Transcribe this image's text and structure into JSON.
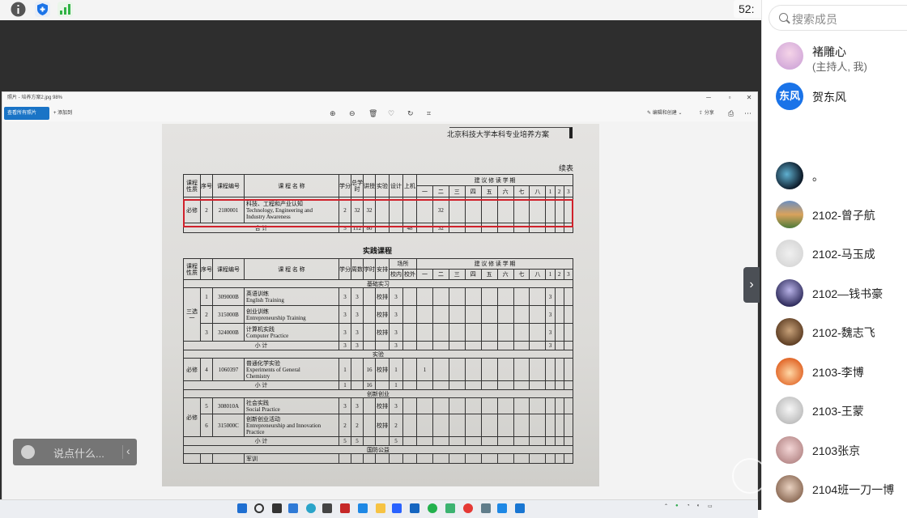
{
  "timer": "52:",
  "viewer": {
    "title": "照片 - 培养方案2.jpg  98%",
    "primary_button": "查看所有照片",
    "add_label": "添加到",
    "edit_label": "编辑和创建",
    "share_label": "分享"
  },
  "paper": {
    "header": "北京科技大学本科专业培养方案",
    "continued": "续表",
    "section_practice": "实践课程"
  },
  "table1": {
    "headers": {
      "nature": "课程性质",
      "seq": "序号",
      "code": "课程编号",
      "name": "课 程 名 称",
      "credit": "学分",
      "total_hours": "总学时",
      "lecture": "讲授",
      "experiment": "实验",
      "design": "设计",
      "computer": "上机",
      "semester": "建 议 修 读 学 期",
      "semesters": [
        "一",
        "二",
        "三",
        "四",
        "五",
        "六",
        "七",
        "八",
        "1",
        "2",
        "3"
      ]
    },
    "row": {
      "nature": "必修",
      "seq": "2",
      "code": "2180001",
      "name_cn": "科技、工程和产业认知",
      "name_en1": "Technology, Engineering and",
      "name_en2": "Industry Awareness",
      "credit": "2",
      "total_hours": "32",
      "lecture": "32",
      "sem2": "32"
    },
    "total": {
      "label": "合 计",
      "credit": "5",
      "total_hours": "112",
      "lecture": "80",
      "computer": "48",
      "sem2": "32"
    }
  },
  "table2": {
    "headers": {
      "nature": "课程性质",
      "seq": "序号",
      "code": "课程编号",
      "name": "课 程 名 称",
      "credit": "学分",
      "weeks": "周数",
      "hours": "学时",
      "arrange": "安排",
      "place": "场所",
      "in_school": "校内",
      "out_school": "校外",
      "semester": "建 议 修 读 学 期"
    },
    "group_basic": "基础实习",
    "basic_nature": "三选一",
    "basic_rows": [
      {
        "seq": "1",
        "code": "309000B",
        "cn": "英语训练",
        "en": "English Training",
        "credit": "3",
        "weeks": "3",
        "arrange": "校排",
        "in": "3",
        "s1": "3"
      },
      {
        "seq": "2",
        "code": "315000B",
        "cn": "创业训练",
        "en": "Entrepreneurship Training",
        "credit": "3",
        "weeks": "3",
        "arrange": "校排",
        "in": "3",
        "s1": "3"
      },
      {
        "seq": "3",
        "code": "324000B",
        "cn": "计算机实践",
        "en": "Computer Practice",
        "credit": "3",
        "weeks": "3",
        "arrange": "校排",
        "in": "3",
        "s1": "3"
      }
    ],
    "subtotal_label": "小 计",
    "basic_subtotal": {
      "credit": "3",
      "weeks": "3",
      "in": "3",
      "s1": "3"
    },
    "group_exp": "实验",
    "exp_nature": "必修",
    "exp_row": {
      "seq": "4",
      "code": "1060397",
      "cn": "普通化学实验",
      "en1": "Experiments of General",
      "en2": "Chemistry",
      "credit": "1",
      "hours": "16",
      "arrange": "校排",
      "in": "1",
      "s": "1"
    },
    "exp_subtotal": {
      "credit": "1",
      "hours": "16",
      "in": "1"
    },
    "group_innov": "创新创业",
    "innov_nature": "必修",
    "innov_rows": [
      {
        "seq": "5",
        "code": "308010A",
        "cn": "社会实践",
        "en": "Social Practice",
        "credit": "3",
        "weeks": "3",
        "arrange": "校排",
        "in": "3"
      },
      {
        "seq": "6",
        "code": "315000C",
        "cn": "创新创业活动",
        "en1": "Entrepreneurship and Innovation",
        "en2": "Practice",
        "credit": "2",
        "weeks": "2",
        "arrange": "校排",
        "in": "2"
      }
    ],
    "innov_subtotal": {
      "credit": "5",
      "weeks": "5",
      "in": "5"
    },
    "group_defense": "国防公益",
    "defense_row_cn": "军训"
  },
  "chat": {
    "placeholder": "说点什么..."
  },
  "panel": {
    "search_placeholder": "搜索成员",
    "members": [
      {
        "name": "褚雕心",
        "role": "(主持人, 我)"
      },
      {
        "name": "贺东风",
        "avatar_text": "东风"
      },
      {
        "name": "。"
      },
      {
        "name": "2102-曾子航"
      },
      {
        "name": "2102-马玉成"
      },
      {
        "name": "2102—钱书豪"
      },
      {
        "name": "2102-魏志飞"
      },
      {
        "name": "2103-李博"
      },
      {
        "name": "2103-王蒙"
      },
      {
        "name": "2103张京"
      },
      {
        "name": "2104班一刀一博"
      }
    ]
  },
  "colors": {
    "accent": "#1a74c6",
    "highlight_box": "#d0212b",
    "share_bg": "#2e2e2e"
  }
}
